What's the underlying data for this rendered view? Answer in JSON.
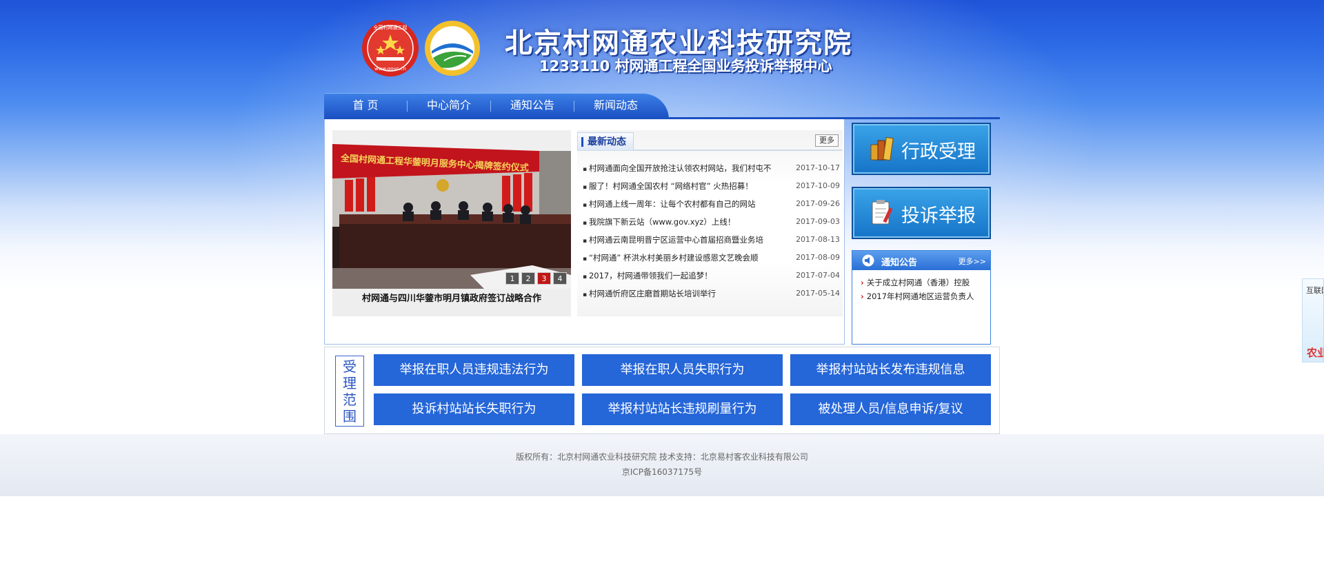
{
  "header": {
    "title": "北京村网通农业科技研究院",
    "subtitle": "1233110 村网通工程全国业务投诉举报中心",
    "emblem_text": "全国村网通工程",
    "emblem_url": "www.govc.cn"
  },
  "nav": {
    "items": [
      {
        "label": "首 页"
      },
      {
        "label": "中心简介"
      },
      {
        "label": "通知公告"
      },
      {
        "label": "新闻动态"
      }
    ]
  },
  "slider": {
    "banner_text": "全国村网通工程华蓥明月服务中心揭牌签约仪式",
    "caption": "村网通与四川华蓥市明月镇政府签订战略合作",
    "dots": [
      "1",
      "2",
      "3",
      "4"
    ],
    "active_dot": 3
  },
  "news": {
    "title": "最新动态",
    "more_label": "更多",
    "items": [
      {
        "title": "村网通面向全国开放抢注认领农村网站，我们村屯不",
        "date": "2017-10-17"
      },
      {
        "title": "服了！村网通全国农村 “网络村官” 火热招募！",
        "date": "2017-10-09"
      },
      {
        "title": "村网通上线一周年：让每个农村都有自己的网站",
        "date": "2017-09-26"
      },
      {
        "title": "我院旗下新云站（www.gov.xyz）上线！",
        "date": "2017-09-03"
      },
      {
        "title": "村网通云南昆明晋宁区运营中心首届招商暨业务培",
        "date": "2017-08-13"
      },
      {
        "title": "“村网通” 杯洪水村美丽乡村建设感恩文艺晚会顺",
        "date": "2017-08-09"
      },
      {
        "title": "2017，村网通带领我们一起追梦！",
        "date": "2017-07-04"
      },
      {
        "title": "村网通忻府区庄磨首期站长培训举行",
        "date": "2017-05-14"
      }
    ]
  },
  "actions": {
    "admin_label": "行政受理",
    "complaint_label": "投诉举报"
  },
  "notice": {
    "title": "通知公告",
    "more_label": "更多>>",
    "items": [
      {
        "title": "关于成立村网通（香港）控股"
      },
      {
        "title": "2017年村网通地区运营负责人"
      }
    ]
  },
  "range": {
    "label_chars": [
      "受",
      "理",
      "范",
      "围"
    ],
    "buttons": [
      {
        "label": "举报在职人员违规违法行为"
      },
      {
        "label": "举报在职人员失职行为"
      },
      {
        "label": "举报村站站长发布违规信息"
      },
      {
        "label": "投诉村站站长失职行为"
      },
      {
        "label": "举报村站站长违规刷量行为"
      },
      {
        "label": "被处理人员/信息申诉/复议"
      }
    ]
  },
  "footer": {
    "copyright": "版权所有：北京村网通农业科技研究院 技术支持：北京易村客农业科技有限公司",
    "icp": "京ICP备16037175号"
  },
  "side_float": {
    "top_text": "互联网",
    "bottom_text": "农业"
  },
  "colors": {
    "primary_blue": "#2566d8",
    "nav_blue": "#1a4fc2",
    "accent_red": "#c01717"
  }
}
